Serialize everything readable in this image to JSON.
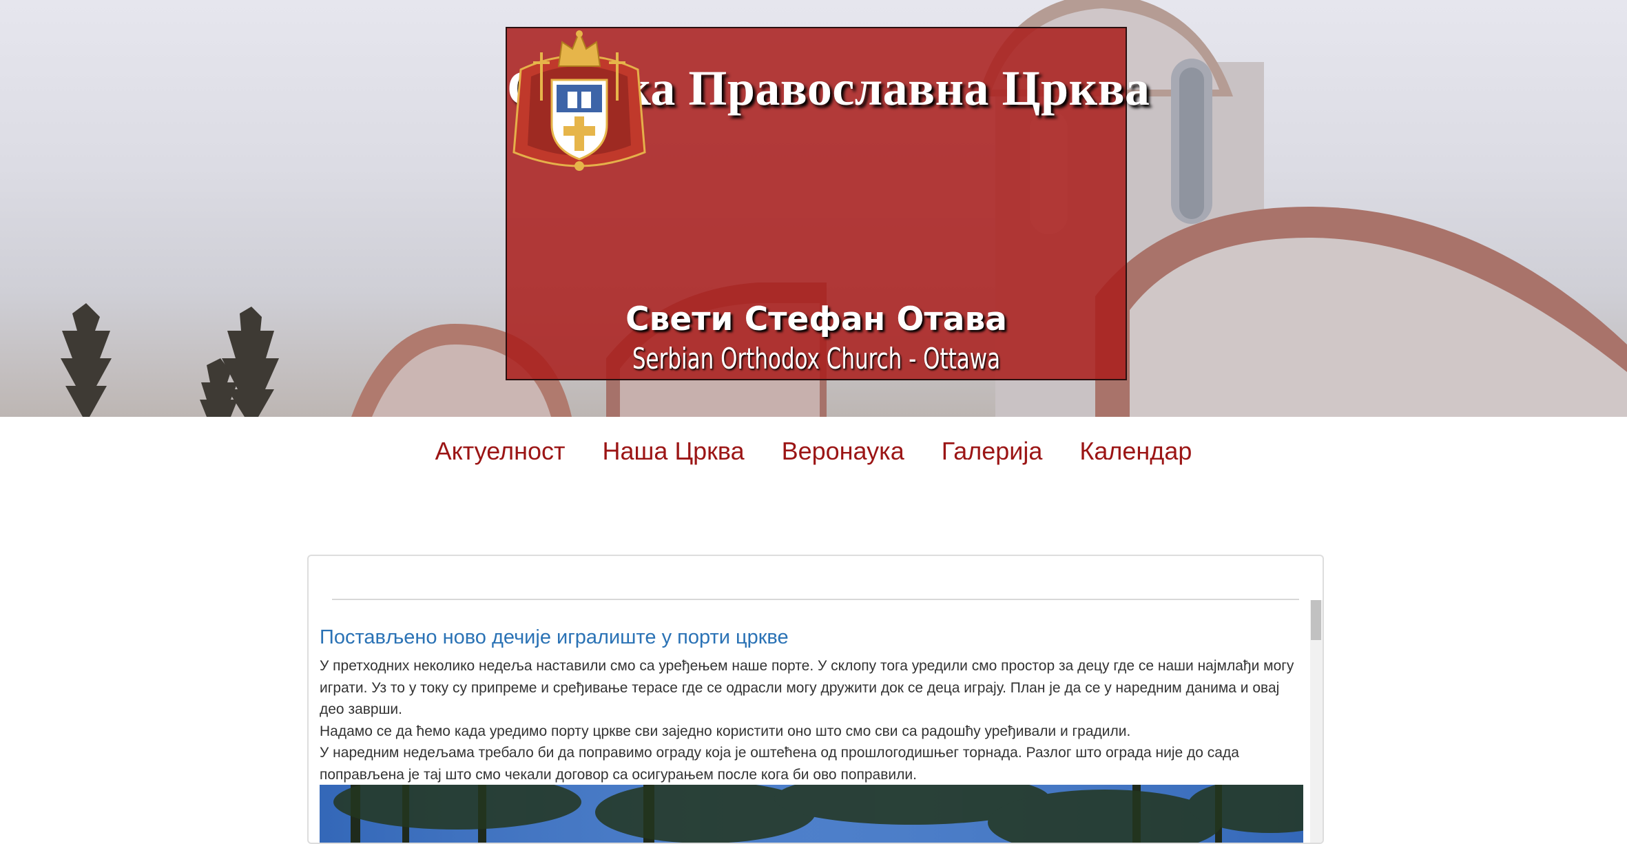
{
  "header": {
    "title": "Српска Православна Црква",
    "subtitle": "Свети Стефан Отава",
    "subtitle_en": "Serbian Orthodox Church - Ottawa"
  },
  "nav": {
    "items": [
      {
        "label": "Актуелност"
      },
      {
        "label": "Наша Црква"
      },
      {
        "label": "Веронаука"
      },
      {
        "label": "Галерија"
      },
      {
        "label": "Календар"
      }
    ]
  },
  "post": {
    "title": "Постављено ново дечије игралиште у порти цркве",
    "paragraphs": [
      "У претходних неколико недеља наставили смо са уређењем наше порте. У склопу тога уредили смо простор за децу где се наши најмлађи могу играти. Уз то у току су припреме и сређивање терасе где се одрасли могу дружити док се деца играју. План је да се у наредним данима и овај део заврши.",
      "Надамо се да ћемо када уредимо порту цркве сви заједно користити оно што смо сви са радошћу уређивали и градили.",
      "У наредним недељама требало би да поправимо ограду која је оштећена од прошлогодишњег торнада. Разлог што ограда није до сада поправљена је тај што смо чекали договор са осигурањем после кога би ово поправили."
    ]
  },
  "colors": {
    "nav_link": "#9b1515",
    "post_title": "#2a72b5",
    "title_box": "#aa1e1c"
  }
}
